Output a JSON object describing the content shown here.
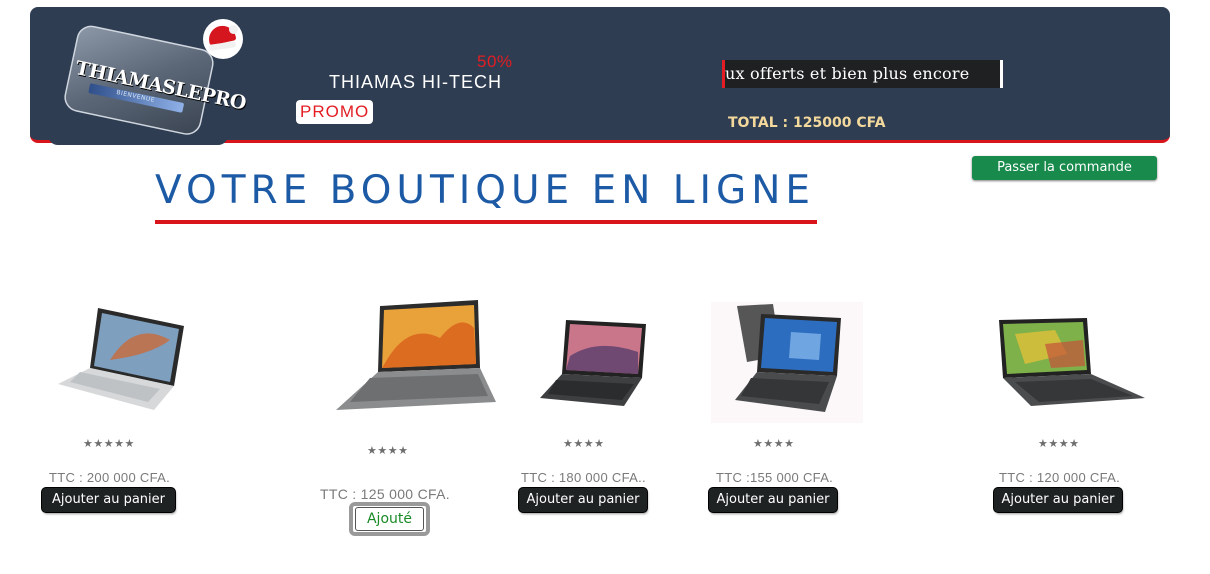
{
  "header": {
    "logo_text": "THIAMASLEPRO",
    "logo_subtext": "BIENVENUE",
    "discount": "50%",
    "brand": "THIAMAS HI-TECH",
    "promo_label": "PROMO",
    "marquee_text": "ux offerts et bien plus encore",
    "total": "TOTAL : 125000 CFA"
  },
  "order_button": "Passer la commande",
  "page_title": "VOTRE BOUTIQUE EN LIGNE",
  "products": [
    {
      "stars": "★★★★★",
      "rating": 5,
      "price": "TTC : 200 000 CFA.",
      "button": "Ajouter au panier"
    },
    {
      "stars": "★★★★",
      "rating": 4,
      "price": "TTC : 125 000 CFA.",
      "button": "Ajouté"
    },
    {
      "stars": "★★★★",
      "rating": 4,
      "price": "TTC : 180 000 CFA..",
      "button": "Ajouter au panier"
    },
    {
      "stars": "★★★★",
      "rating": 4,
      "price": "TTC :155 000 CFA.",
      "button": "Ajouter au panier"
    },
    {
      "stars": "★★★★",
      "rating": 4,
      "price": "TTC : 120 000 CFA.",
      "button": "Ajouter au panier"
    }
  ],
  "colors": {
    "header_bg": "#2e3d52",
    "accent_red": "#d9151b",
    "title_blue": "#1d5aa6",
    "order_green": "#178a4c",
    "total_gold": "#f4d99d"
  }
}
